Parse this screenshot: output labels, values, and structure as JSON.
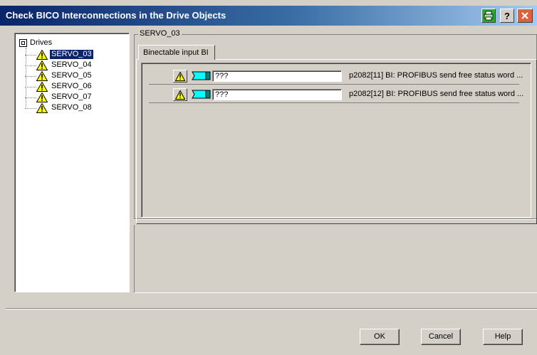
{
  "window": {
    "title": "Check BICO Interconnections in the Drive Objects"
  },
  "tree": {
    "root_label": "Drives",
    "items": [
      {
        "label": "SERVO_03",
        "selected": true
      },
      {
        "label": "SERVO_04"
      },
      {
        "label": "SERVO_05"
      },
      {
        "label": "SERVO_06"
      },
      {
        "label": "SERVO_07"
      },
      {
        "label": "SERVO_08"
      }
    ]
  },
  "group": {
    "label": "SERVO_03",
    "tab_label": "Binectable input BI"
  },
  "rows": [
    {
      "value": "???",
      "description": "p2082[11] BI: PROFIBUS send free status word ..."
    },
    {
      "value": "???",
      "description": "p2082[12] BI: PROFIBUS send free status word ..."
    }
  ],
  "buttons": {
    "ok": "OK",
    "cancel": "Cancel",
    "help": "Help"
  },
  "colors": {
    "title_gradient_start": "#0a246a",
    "title_gradient_end": "#a6caf0",
    "warning": "#ffff00",
    "bico_connector": "#00ffff",
    "close": "#e0603a"
  }
}
